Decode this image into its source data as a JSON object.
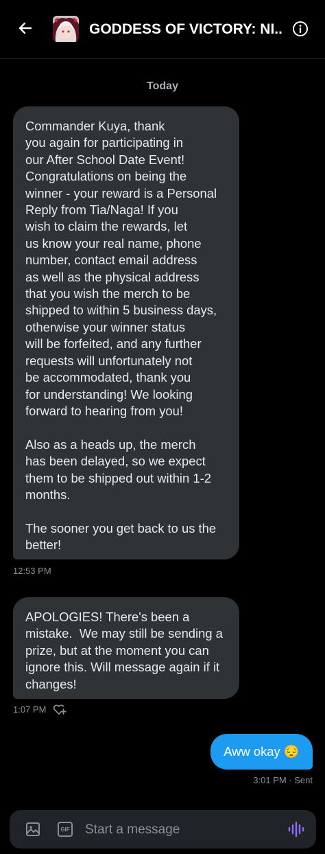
{
  "header": {
    "title": "GODDESS OF VICTORY: NI...",
    "back_icon": "arrow-left-icon",
    "info_icon": "info-circle-icon"
  },
  "conversation": {
    "date_separator": "Today",
    "messages": [
      {
        "direction": "received",
        "text": "Commander Kuya, thank\nyou again for participating in\nour After School Date Event!\nCongratulations on being the\nwinner - your reward is a Personal\nReply from Tia/Naga! If you\nwish to claim the rewards, let\nus know your real name, phone\nnumber, contact email address\nas well as the physical address\nthat you wish the merch to be\nshipped to within 5 business days,\notherwise your winner status\nwill be forfeited, and any further\nrequests will unfortunately not\nbe accommodated, thank you\nfor understanding! We looking\nforward to hearing from you!\n\nAlso as a heads up, the merch\nhas been delayed, so we expect\nthem to be shipped out within 1-2\nmonths.\n\nThe sooner you get back to us the\nbetter!",
        "time": "12:53 PM"
      },
      {
        "direction": "received",
        "text": "APOLOGIES! There's been a\nmistake.  We may still be sending a\nprize, but at the moment you can\nignore this. Will message again if it\nchanges!",
        "time": "1:07 PM",
        "react_icon": "add-reaction-icon"
      },
      {
        "direction": "sent",
        "text": "Aww okay 😔",
        "time": "3:01 PM · Sent"
      }
    ]
  },
  "composer": {
    "placeholder": "Start a message",
    "media_icon": "image-icon",
    "gif_label": "GIF",
    "voice_icon": "voice-message-icon"
  },
  "colors": {
    "background": "#000000",
    "received_bubble": "#2f3336",
    "sent_bubble": "#1d9bf0",
    "voice_accent": "#8b6cff",
    "muted_text": "#8b9096"
  }
}
